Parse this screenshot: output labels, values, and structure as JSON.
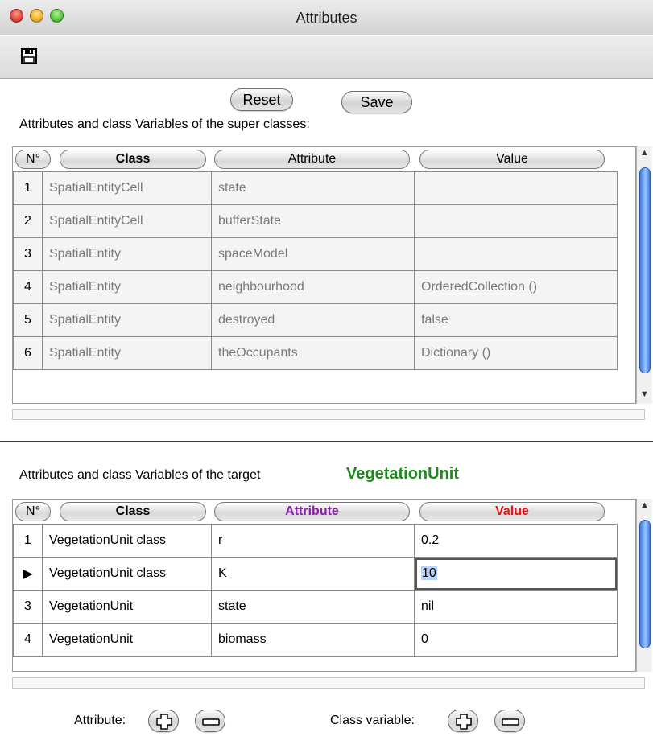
{
  "window": {
    "title": "Attributes"
  },
  "toolbar": {
    "save_icon": "floppy-disk-icon"
  },
  "buttons": {
    "reset": "Reset",
    "save": "Save"
  },
  "super_section": {
    "label": "Attributes and class Variables of the super classes:",
    "columns": [
      "N°",
      "Class",
      "Attribute",
      "Value"
    ],
    "rows": [
      {
        "n": "1",
        "cls": "SpatialEntityCell",
        "attr": "state",
        "val": ""
      },
      {
        "n": "2",
        "cls": "SpatialEntityCell",
        "attr": "bufferState",
        "val": ""
      },
      {
        "n": "3",
        "cls": "SpatialEntity",
        "attr": "spaceModel",
        "val": ""
      },
      {
        "n": "4",
        "cls": "SpatialEntity",
        "attr": "neighbourhood",
        "val": "OrderedCollection ()"
      },
      {
        "n": "5",
        "cls": "SpatialEntity",
        "attr": "destroyed",
        "val": "false"
      },
      {
        "n": "6",
        "cls": "SpatialEntity",
        "attr": "theOccupants",
        "val": "Dictionary ()"
      }
    ]
  },
  "target_section": {
    "label": "Attributes and class Variables of the target",
    "class_name": "VegetationUnit",
    "class_color": "#1e8a1e",
    "columns": [
      "N°",
      "Class",
      "Attribute",
      "Value"
    ],
    "attribute_header_color": "#8b1fa8",
    "value_header_color": "#ee1111",
    "rows": [
      {
        "n": "1",
        "cls": "VegetationUnit class",
        "attr": "r",
        "val": "0.2"
      },
      {
        "n": "▶",
        "cls": "VegetationUnit class",
        "attr": "K",
        "val": "10"
      },
      {
        "n": "3",
        "cls": "VegetationUnit",
        "attr": "state",
        "val": "nil"
      },
      {
        "n": "4",
        "cls": "VegetationUnit",
        "attr": "biomass",
        "val": "0"
      }
    ]
  },
  "footer": {
    "attribute_label": "Attribute:",
    "class_variable_label": "Class variable:"
  }
}
